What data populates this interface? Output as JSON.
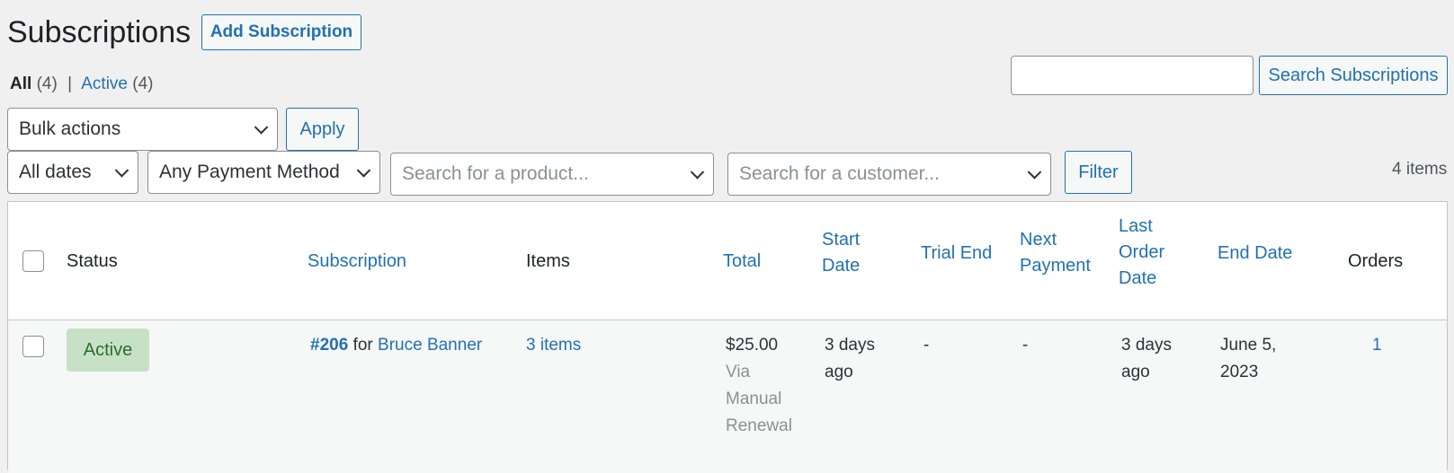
{
  "page": {
    "title": "Subscriptions",
    "add_button": "Add Subscription"
  },
  "views": {
    "all_label": "All",
    "all_count": "(4)",
    "separator": "|",
    "active_label": "Active",
    "active_count": "(4)"
  },
  "search": {
    "value": "",
    "button": "Search Subscriptions"
  },
  "bulk": {
    "selected": "Bulk actions",
    "apply": "Apply"
  },
  "filters": {
    "dates": "All dates",
    "payment": "Any Payment Method",
    "product_placeholder": "Search for a product...",
    "customer_placeholder": "Search for a customer...",
    "filter_button": "Filter",
    "item_count": "4 items"
  },
  "table": {
    "headers": {
      "status": "Status",
      "subscription": "Subscription",
      "items": "Items",
      "total": "Total",
      "start_date_1": "Start",
      "start_date_2": "Date",
      "trial_end": "Trial End",
      "next_payment_1": "Next",
      "next_payment_2": "Payment",
      "last_order_1": "Last",
      "last_order_2": "Order",
      "last_order_3": "Date",
      "end_date": "End Date",
      "orders": "Orders"
    },
    "rows": [
      {
        "status": "Active",
        "sub_number": "#206",
        "sub_for": "for",
        "customer": "Bruce Banner",
        "items": "3 items",
        "total": "$25.00",
        "via_1": "Via",
        "via_2": "Manual",
        "via_3": "Renewal",
        "start_1": "3 days",
        "start_2": "ago",
        "trial_end": "-",
        "next_payment": "-",
        "last_order_1": "3 days",
        "last_order_2": "ago",
        "end_1": "June 5,",
        "end_2": "2023",
        "orders": "1"
      }
    ]
  },
  "colors": {
    "accent": "#2271b1",
    "active_badge_bg": "#c6e1c6",
    "active_badge_text": "#2c6e2c",
    "background": "#f0f0f1"
  }
}
